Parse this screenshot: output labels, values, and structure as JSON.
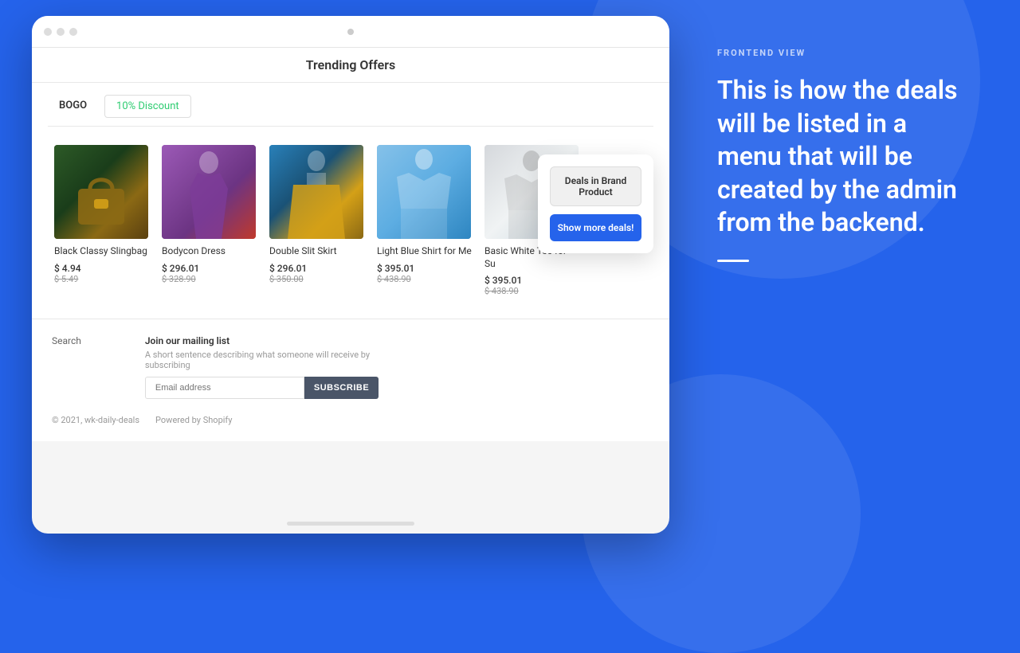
{
  "browser": {
    "trending_title": "Trending Offers",
    "tabs": [
      {
        "id": "bogo",
        "label": "BOGO",
        "active": true
      },
      {
        "id": "discount",
        "label": "10% Discount",
        "active": false
      }
    ],
    "products": [
      {
        "id": 1,
        "title": "Black Classy Slingbag",
        "price": "$ 4.94",
        "original_price": "$ 5.49",
        "img_class": "img-slingbag"
      },
      {
        "id": 2,
        "title": "Bodycon Dress",
        "price": "$ 296.01",
        "original_price": "$ 328.90",
        "img_class": "img-dress"
      },
      {
        "id": 3,
        "title": "Double Slit Skirt",
        "price": "$ 296.01",
        "original_price": "$ 350.00",
        "img_class": "img-skirt"
      },
      {
        "id": 4,
        "title": "Light Blue Shirt for Me",
        "price": "$ 395.01",
        "original_price": "$ 438.90",
        "img_class": "img-shirt-blue"
      },
      {
        "id": 5,
        "title": "Basic White Tee for Su",
        "price": "$ 395.01",
        "original_price": "$ 438.90",
        "img_class": "img-tee-white"
      }
    ],
    "floating_card": {
      "deals_label": "Deals in Brand Product",
      "show_more_label": "Show more deals!"
    },
    "footer": {
      "search_label": "Search",
      "mailing_title": "Join our mailing list",
      "mailing_desc": "A short sentence describing what someone will receive by subscribing",
      "email_placeholder": "Email address",
      "subscribe_label": "SUBSCRIBE",
      "copyright": "© 2021, wk-daily-deals",
      "powered_by": "Powered by Shopify"
    }
  },
  "right_panel": {
    "section_label": "FRONTEND VIEW",
    "description": "This is how the deals will be listed in a menu that will be created by the admin from the backend."
  }
}
